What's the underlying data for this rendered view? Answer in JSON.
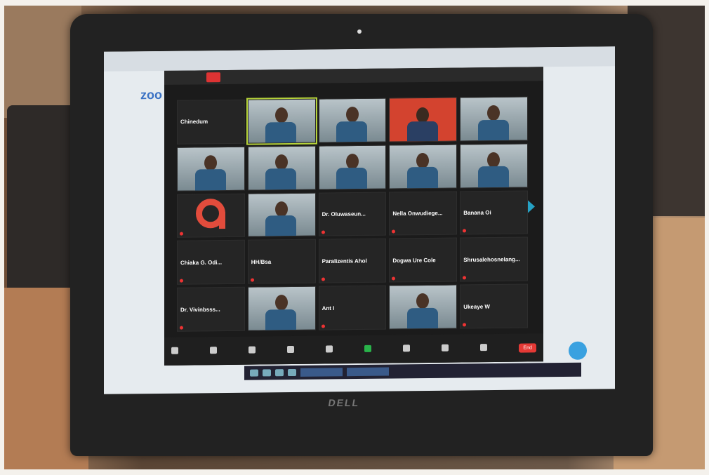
{
  "screen": {
    "app_logo": "zoo",
    "tiles": [
      {
        "label": "Chinedum"
      },
      {
        "label": ""
      },
      {
        "label": ""
      },
      {
        "label": ""
      },
      {
        "label": ""
      },
      {
        "label": ""
      },
      {
        "label": ""
      },
      {
        "label": ""
      },
      {
        "label": ""
      },
      {
        "label": ""
      },
      {
        "label": ""
      },
      {
        "label": ""
      },
      {
        "label": "Dr. Oluwaseun..."
      },
      {
        "label": "Nella Onwudiege..."
      },
      {
        "label": "Banana Oi"
      },
      {
        "label": "Chiaka G. Odi..."
      },
      {
        "label": "HH/Bsa"
      },
      {
        "label": "Paralizentis Ahol"
      },
      {
        "label": "Dogwa Ure Cole"
      },
      {
        "label": "Shrusalehosnelang..."
      },
      {
        "label": "Dr. Vivinbsss..."
      },
      {
        "label": ""
      },
      {
        "label": "Ant I"
      },
      {
        "label": ""
      },
      {
        "label": "Ukeaye W"
      }
    ],
    "end_button": "End",
    "brand": "DELL"
  }
}
